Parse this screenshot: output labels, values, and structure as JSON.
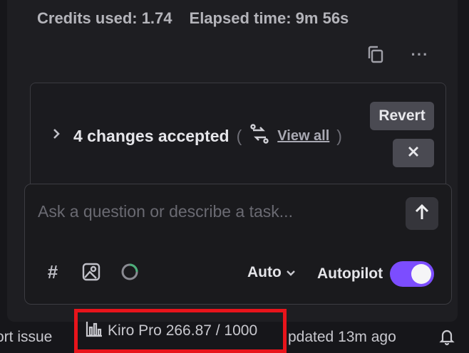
{
  "session": {
    "credits_used": "Credits used: 1.74",
    "elapsed_time": "Elapsed time: 9m 56s",
    "actions": [
      {
        "icon": "copy-icon"
      },
      {
        "icon": "more-icon",
        "glyph": "···"
      }
    ]
  },
  "changes": {
    "title": "4 changes accepted",
    "paren_open": "(",
    "paren_close": ")",
    "view_all": "View all",
    "revert_label": "Revert",
    "reject_glyph": "✕"
  },
  "composer": {
    "placeholder": "Ask a question or describe a task...",
    "value": "",
    "tools": [
      {
        "icon": "hash-icon",
        "glyph": "#"
      },
      {
        "icon": "image-icon"
      },
      {
        "icon": "spinner-icon"
      }
    ],
    "mode_label": "Auto",
    "autopilot_label": "Autopilot",
    "autopilot_on": true
  },
  "statusbar": {
    "report_issue": "ort issue",
    "plan": "Kiro Pro 266.87 / 1000",
    "updated": "pdated 13m ago"
  },
  "colors": {
    "accent": "#7c4dff",
    "highlight": "#e8141b",
    "panel_bg": "#1e1e22"
  }
}
